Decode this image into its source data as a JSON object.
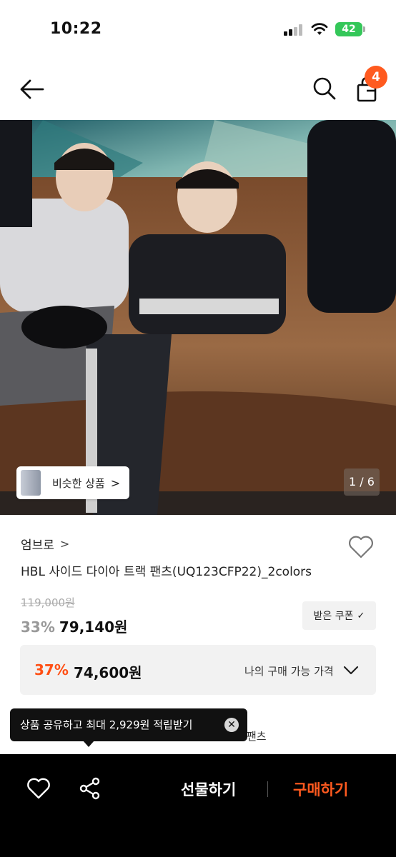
{
  "status_bar": {
    "time": "10:22",
    "battery": "42"
  },
  "nav": {
    "cart_count": "4"
  },
  "hero": {
    "similar_label": "비슷한 상품",
    "similar_arrow": ">",
    "page_counter": "1 / 6"
  },
  "product": {
    "brand": "엄브로",
    "brand_chevron": ">",
    "title": "HBL 사이드 다이아 트랙 팬츠(UQ123CFP22)_2colors",
    "original_price": "119,000원",
    "discount_rate": "33%",
    "sale_price": "79,140원",
    "coupon_label": "받은 쿠폰",
    "coupon_check": "✓"
  },
  "my_price": {
    "rate": "37%",
    "price": "74,600원",
    "label": "나의 구매 가능 가격"
  },
  "tooltip": {
    "text": "상품 공유하고 최대 2,929원 적립받기",
    "close": "✕"
  },
  "peek_text": "팬츠",
  "bottom_bar": {
    "gift_label": "선물하기",
    "buy_label": "구매하기"
  },
  "colors": {
    "accent": "#ff5a1f",
    "discount_orange": "#ff4f14",
    "battery_green": "#34c759"
  }
}
